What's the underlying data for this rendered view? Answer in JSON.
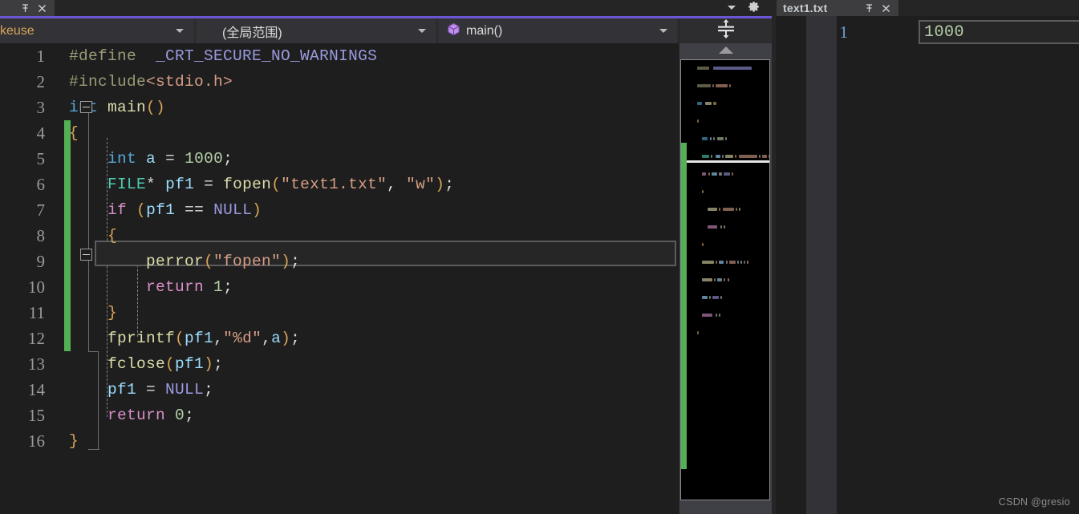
{
  "tabs": {
    "left": {
      "title": "",
      "pin_icon": "pin-icon",
      "close_icon": "close-icon"
    },
    "right": {
      "title": "text1.txt",
      "pin_icon": "pin-icon",
      "close_icon": "close-icon"
    }
  },
  "top_right": {
    "chevron_icon": "chevron-down-icon",
    "gear_icon": "gear-icon"
  },
  "navbar": {
    "project_combo": {
      "value": "keuse",
      "arrow_icon": "chevron-down-icon"
    },
    "scope_combo": {
      "value": "(全局范围)",
      "arrow_icon": "chevron-down-icon"
    },
    "member_combo": {
      "value": "main()",
      "icon": "method-cube-icon",
      "arrow_icon": "chevron-down-icon"
    },
    "splitter": {
      "icon": "split-horizontal-icon"
    }
  },
  "editor": {
    "language": "C",
    "current_line": 7,
    "lines": [
      {
        "no": "1",
        "tokens": [
          {
            "text": "#define",
            "cls": "t-pre"
          },
          {
            "text": "  ",
            "cls": "t-plain"
          },
          {
            "text": "_CRT_SECURE_NO_WARNINGS",
            "cls": "t-macro"
          }
        ]
      },
      {
        "no": "2",
        "tokens": [
          {
            "text": "#include",
            "cls": "t-pre"
          },
          {
            "text": "<",
            "cls": "t-str"
          },
          {
            "text": "stdio.h",
            "cls": "t-str"
          },
          {
            "text": ">",
            "cls": "t-str"
          }
        ]
      },
      {
        "no": "3",
        "tokens": [
          {
            "text": "int",
            "cls": "t-type"
          },
          {
            "text": " ",
            "cls": "t-plain"
          },
          {
            "text": "main",
            "cls": "t-func"
          },
          {
            "text": "()",
            "cls": "t-punc"
          }
        ]
      },
      {
        "no": "4",
        "tokens": [
          {
            "text": "{",
            "cls": "t-punc"
          }
        ]
      },
      {
        "no": "5",
        "tokens": [
          {
            "text": "    ",
            "cls": "t-plain"
          },
          {
            "text": "int",
            "cls": "t-type"
          },
          {
            "text": " ",
            "cls": "t-plain"
          },
          {
            "text": "a",
            "cls": "t-var"
          },
          {
            "text": " = ",
            "cls": "t-op"
          },
          {
            "text": "1000",
            "cls": "t-num"
          },
          {
            "text": ";",
            "cls": "t-plain"
          }
        ]
      },
      {
        "no": "6",
        "tokens": [
          {
            "text": "    ",
            "cls": "t-plain"
          },
          {
            "text": "FILE",
            "cls": "t-ctype"
          },
          {
            "text": "*",
            "cls": "t-op"
          },
          {
            "text": " ",
            "cls": "t-plain"
          },
          {
            "text": "pf1",
            "cls": "t-var"
          },
          {
            "text": " = ",
            "cls": "t-op"
          },
          {
            "text": "fopen",
            "cls": "t-func"
          },
          {
            "text": "(",
            "cls": "t-punc"
          },
          {
            "text": "\"text1.txt\"",
            "cls": "t-str"
          },
          {
            "text": ", ",
            "cls": "t-plain"
          },
          {
            "text": "\"w\"",
            "cls": "t-str"
          },
          {
            "text": ")",
            "cls": "t-punc"
          },
          {
            "text": ";",
            "cls": "t-plain"
          }
        ]
      },
      {
        "no": "7",
        "tokens": [
          {
            "text": "    ",
            "cls": "t-plain"
          },
          {
            "text": "if",
            "cls": "t-kw"
          },
          {
            "text": " ",
            "cls": "t-plain"
          },
          {
            "text": "(",
            "cls": "t-punc"
          },
          {
            "text": "pf1",
            "cls": "t-var"
          },
          {
            "text": " == ",
            "cls": "t-op"
          },
          {
            "text": "NULL",
            "cls": "t-const"
          },
          {
            "text": ")",
            "cls": "t-punc"
          }
        ]
      },
      {
        "no": "8",
        "tokens": [
          {
            "text": "    ",
            "cls": "t-plain"
          },
          {
            "text": "{",
            "cls": "t-punc"
          }
        ]
      },
      {
        "no": "9",
        "tokens": [
          {
            "text": "        ",
            "cls": "t-plain"
          },
          {
            "text": "perror",
            "cls": "t-func"
          },
          {
            "text": "(",
            "cls": "t-punc"
          },
          {
            "text": "\"fopen\"",
            "cls": "t-str"
          },
          {
            "text": ")",
            "cls": "t-punc"
          },
          {
            "text": ";",
            "cls": "t-plain"
          }
        ]
      },
      {
        "no": "10",
        "tokens": [
          {
            "text": "        ",
            "cls": "t-plain"
          },
          {
            "text": "return",
            "cls": "t-kw"
          },
          {
            "text": " ",
            "cls": "t-plain"
          },
          {
            "text": "1",
            "cls": "t-num"
          },
          {
            "text": ";",
            "cls": "t-plain"
          }
        ]
      },
      {
        "no": "11",
        "tokens": [
          {
            "text": "    ",
            "cls": "t-plain"
          },
          {
            "text": "}",
            "cls": "t-punc"
          }
        ]
      },
      {
        "no": "12",
        "tokens": [
          {
            "text": "    ",
            "cls": "t-plain"
          },
          {
            "text": "fprintf",
            "cls": "t-func"
          },
          {
            "text": "(",
            "cls": "t-punc"
          },
          {
            "text": "pf1",
            "cls": "t-var"
          },
          {
            "text": ",",
            "cls": "t-plain"
          },
          {
            "text": "\"%d\"",
            "cls": "t-str"
          },
          {
            "text": ",",
            "cls": "t-plain"
          },
          {
            "text": "a",
            "cls": "t-var"
          },
          {
            "text": ")",
            "cls": "t-punc"
          },
          {
            "text": ";",
            "cls": "t-plain"
          }
        ]
      },
      {
        "no": "13",
        "tokens": [
          {
            "text": "    ",
            "cls": "t-plain"
          },
          {
            "text": "fclose",
            "cls": "t-func"
          },
          {
            "text": "(",
            "cls": "t-punc"
          },
          {
            "text": "pf1",
            "cls": "t-var"
          },
          {
            "text": ")",
            "cls": "t-punc"
          },
          {
            "text": ";",
            "cls": "t-plain"
          }
        ]
      },
      {
        "no": "14",
        "tokens": [
          {
            "text": "    ",
            "cls": "t-plain"
          },
          {
            "text": "pf1",
            "cls": "t-var"
          },
          {
            "text": " = ",
            "cls": "t-op"
          },
          {
            "text": "NULL",
            "cls": "t-const"
          },
          {
            "text": ";",
            "cls": "t-plain"
          }
        ]
      },
      {
        "no": "15",
        "tokens": [
          {
            "text": "    ",
            "cls": "t-plain"
          },
          {
            "text": "return",
            "cls": "t-kw"
          },
          {
            "text": " ",
            "cls": "t-plain"
          },
          {
            "text": "0",
            "cls": "t-num"
          },
          {
            "text": ";",
            "cls": "t-plain"
          }
        ]
      },
      {
        "no": "16",
        "tokens": [
          {
            "text": "}",
            "cls": "t-punc"
          }
        ]
      }
    ]
  },
  "minimap": {
    "up_arrow_icon": "scroll-up-arrow-icon"
  },
  "right_panel": {
    "line_no": "1",
    "content": "1000"
  },
  "watermark": "CSDN @gresio",
  "colors": {
    "accent": "#6b57d4",
    "change_bar": "#54b054",
    "editor_bg": "#1e1e1e",
    "chrome_bg": "#2d2d30",
    "minimap_bg": "#000000"
  }
}
